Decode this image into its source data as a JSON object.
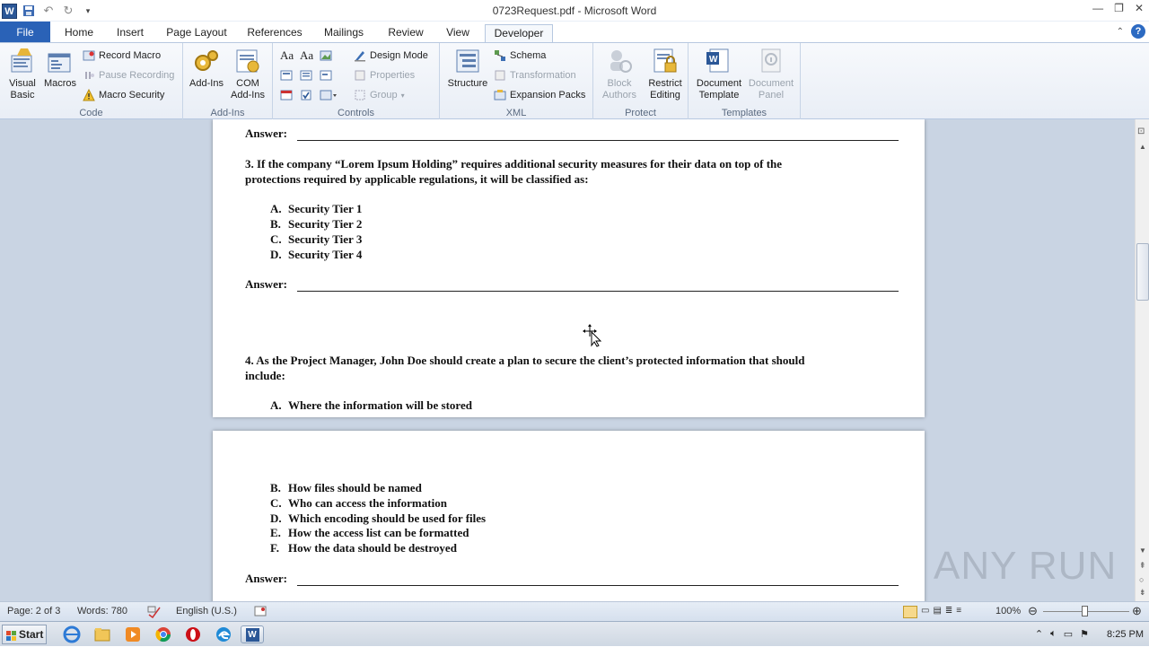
{
  "window": {
    "title": "0723Request.pdf - Microsoft Word"
  },
  "tabs": [
    "File",
    "Home",
    "Insert",
    "Page Layout",
    "References",
    "Mailings",
    "Review",
    "View",
    "Developer"
  ],
  "ribbon": {
    "code": {
      "label": "Code",
      "visual_basic": "Visual Basic",
      "macros": "Macros",
      "record_macro": "Record Macro",
      "pause_recording": "Pause Recording",
      "macro_security": "Macro Security"
    },
    "addins": {
      "label": "Add-Ins",
      "addins": "Add-Ins",
      "com_addins": "COM Add-Ins"
    },
    "controls": {
      "label": "Controls",
      "design_mode": "Design Mode",
      "properties": "Properties",
      "group": "Group"
    },
    "xml": {
      "label": "XML",
      "structure": "Structure",
      "schema": "Schema",
      "transformation": "Transformation",
      "expansion_packs": "Expansion Packs"
    },
    "protect": {
      "label": "Protect",
      "block_authors": "Block Authors",
      "restrict_editing": "Restrict Editing"
    },
    "templates": {
      "label": "Templates",
      "document_template": "Document Template",
      "document_panel": "Document Panel"
    }
  },
  "document": {
    "answer_label": "Answer:",
    "q3": {
      "text_line1": "3. If the company “Lorem Ipsum Holding” requires additional security measures for their data on top of the",
      "text_line2": "protections required by applicable regulations, it will be classified as:",
      "options": [
        {
          "letter": "A.",
          "text": "Security Tier 1"
        },
        {
          "letter": "B.",
          "text": "Security Tier 2"
        },
        {
          "letter": "C.",
          "text": "Security Tier 3"
        },
        {
          "letter": "D.",
          "text": "Security Tier 4"
        }
      ]
    },
    "q4": {
      "text_line1": "4. As the Project Manager, John Doe should create a plan to secure the client’s protected information that should",
      "text_line2": "include:",
      "options_page1": [
        {
          "letter": "A.",
          "text": "Where the information will be stored"
        }
      ],
      "options_page2": [
        {
          "letter": "B.",
          "text": "How files should be named"
        },
        {
          "letter": "C.",
          "text": "Who can access the information"
        },
        {
          "letter": "D.",
          "text": "Which encoding should be used for files"
        },
        {
          "letter": "E.",
          "text": "How the access list can be formatted"
        },
        {
          "letter": "F.",
          "text": "How the data should be destroyed"
        }
      ]
    }
  },
  "status": {
    "page": "Page: 2 of 3",
    "words": "Words: 780",
    "language": "English (U.S.)",
    "zoom": "100%"
  },
  "taskbar": {
    "start": "Start",
    "time": "8:25 PM"
  },
  "watermark": "ANY RUN"
}
